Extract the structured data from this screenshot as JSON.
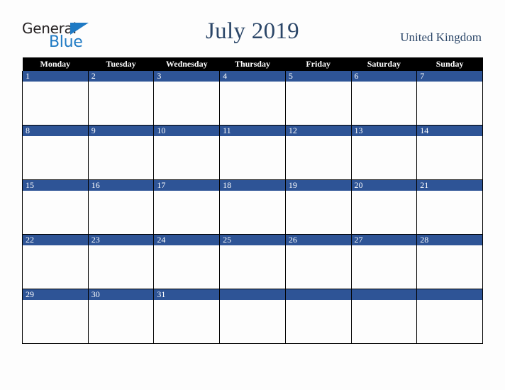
{
  "brand": {
    "name_part1": "General",
    "name_part2": "Blue",
    "triangle_icon": "triangle-icon",
    "accent_color": "#1f7ac4",
    "text_color": "#231f20"
  },
  "header": {
    "title": "July 2019",
    "country": "United Kingdom",
    "title_color": "#2b4668"
  },
  "calendar": {
    "month": "July",
    "year": "2019",
    "week_start": "Monday",
    "header_bg": "#000000",
    "header_text_color": "#ffffff",
    "daynum_bg": "#2e5496",
    "daynum_text_color": "#ffffff",
    "cell_bg": "#fdfdfd",
    "border_color": "#000000",
    "weekdays": [
      "Monday",
      "Tuesday",
      "Wednesday",
      "Thursday",
      "Friday",
      "Saturday",
      "Sunday"
    ],
    "weeks": [
      [
        "1",
        "2",
        "3",
        "4",
        "5",
        "6",
        "7"
      ],
      [
        "8",
        "9",
        "10",
        "11",
        "12",
        "13",
        "14"
      ],
      [
        "15",
        "16",
        "17",
        "18",
        "19",
        "20",
        "21"
      ],
      [
        "22",
        "23",
        "24",
        "25",
        "26",
        "27",
        "28"
      ],
      [
        "29",
        "30",
        "31",
        "",
        "",
        "",
        ""
      ]
    ]
  }
}
